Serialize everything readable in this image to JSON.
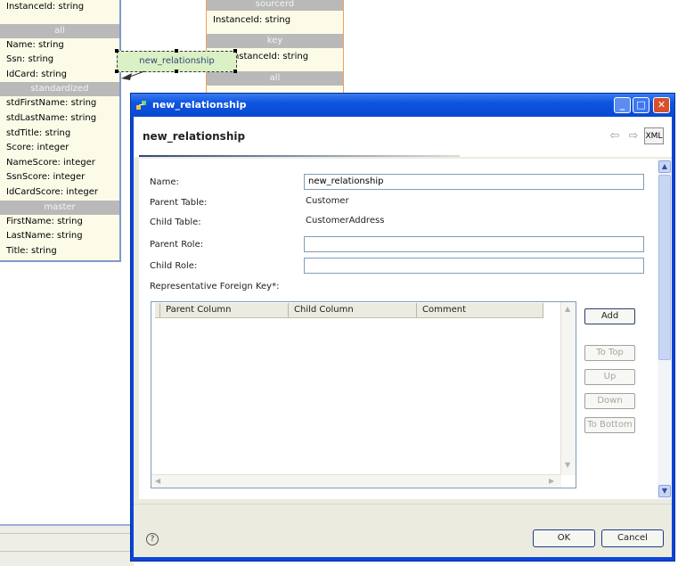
{
  "diagram": {
    "left_entity": {
      "top_row": "InstanceId: string",
      "sections": [
        {
          "header": "all",
          "rows": [
            "Name: string",
            "Ssn: string",
            "IdCard: string"
          ]
        },
        {
          "header": "standardized",
          "rows": [
            "stdFirstName: string",
            "stdLastName: string",
            "stdTitle: string",
            "Score: integer",
            "NameScore: integer",
            "SsnScore: integer",
            "IdCardScore: integer"
          ]
        },
        {
          "header": "master",
          "rows": [
            "FirstName: string",
            "LastName: string",
            "Title: string"
          ]
        }
      ]
    },
    "right_entity": {
      "top_header": "sourcerd",
      "row1": "InstanceId: string",
      "key_header": "key",
      "row2": "merInstanceId: string",
      "all_header": "all"
    },
    "relationship_label": "new_relationship"
  },
  "dialog": {
    "window_title": "new_relationship",
    "header_title": "new_relationship",
    "xml_button": "XML",
    "form": {
      "name_label": "Name:",
      "name_value": "new_relationship",
      "parent_table_label": "Parent Table:",
      "parent_table_value": "Customer",
      "child_table_label": "Child Table:",
      "child_table_value": "CustomerAddress",
      "parent_role_label": "Parent Role:",
      "parent_role_value": "",
      "child_role_label": "Child Role:",
      "child_role_value": "",
      "fk_label": "Representative Foreign Key*:"
    },
    "table": {
      "columns": [
        "Parent Column",
        "Child Column",
        "Comment"
      ]
    },
    "side_buttons": {
      "add": "Add",
      "to_top": "To Top",
      "up": "Up",
      "down": "Down",
      "to_bottom": "To Bottom"
    },
    "footer": {
      "ok": "OK",
      "cancel": "Cancel"
    }
  }
}
